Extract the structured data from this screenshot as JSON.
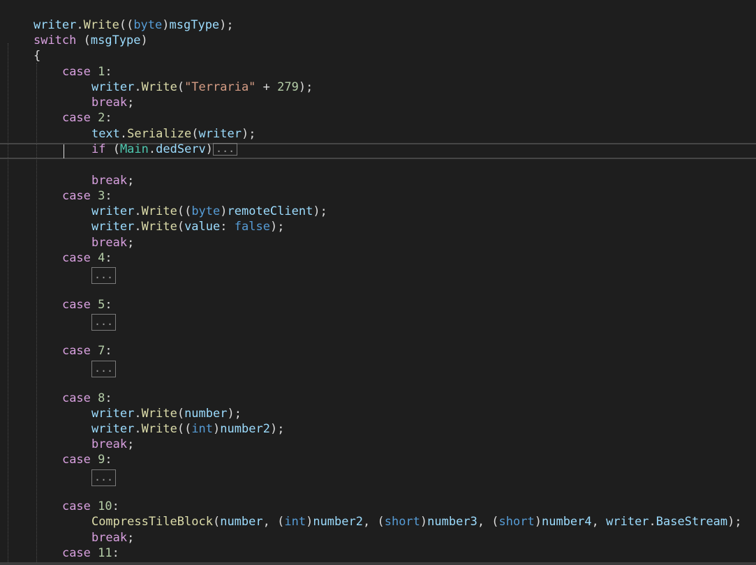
{
  "tokens": {
    "writer": "writer",
    "dot": ".",
    "Write": "Write",
    "lparen": "(",
    "rparen": ")",
    "semi": ";",
    "byte": "byte",
    "int": "int",
    "short": "short",
    "msgType": "msgType",
    "switch": "switch",
    "case": "case",
    "break": "break",
    "if": "if",
    "colon": ":",
    "lbrace": "{",
    "comma": ", ",
    "plus": " + ",
    "text": "text",
    "Serialize": "Serialize",
    "Main": "Main",
    "dedServ": "dedServ",
    "remoteClient": "remoteClient",
    "value_label": "value",
    "false": "false",
    "number": "number",
    "number2": "number2",
    "number3": "number3",
    "number4": "number4",
    "CompressTileBlock": "CompressTileBlock",
    "BaseStream": "BaseStream",
    "terraria_str": "\"Terraria\"",
    "n279": "279",
    "ellipsis": "...",
    "c1": "1",
    "c2": "2",
    "c3": "3",
    "c4": "4",
    "c5": "5",
    "c7": "7",
    "c8": "8",
    "c9": "9",
    "c10": "10",
    "c11": "11"
  }
}
